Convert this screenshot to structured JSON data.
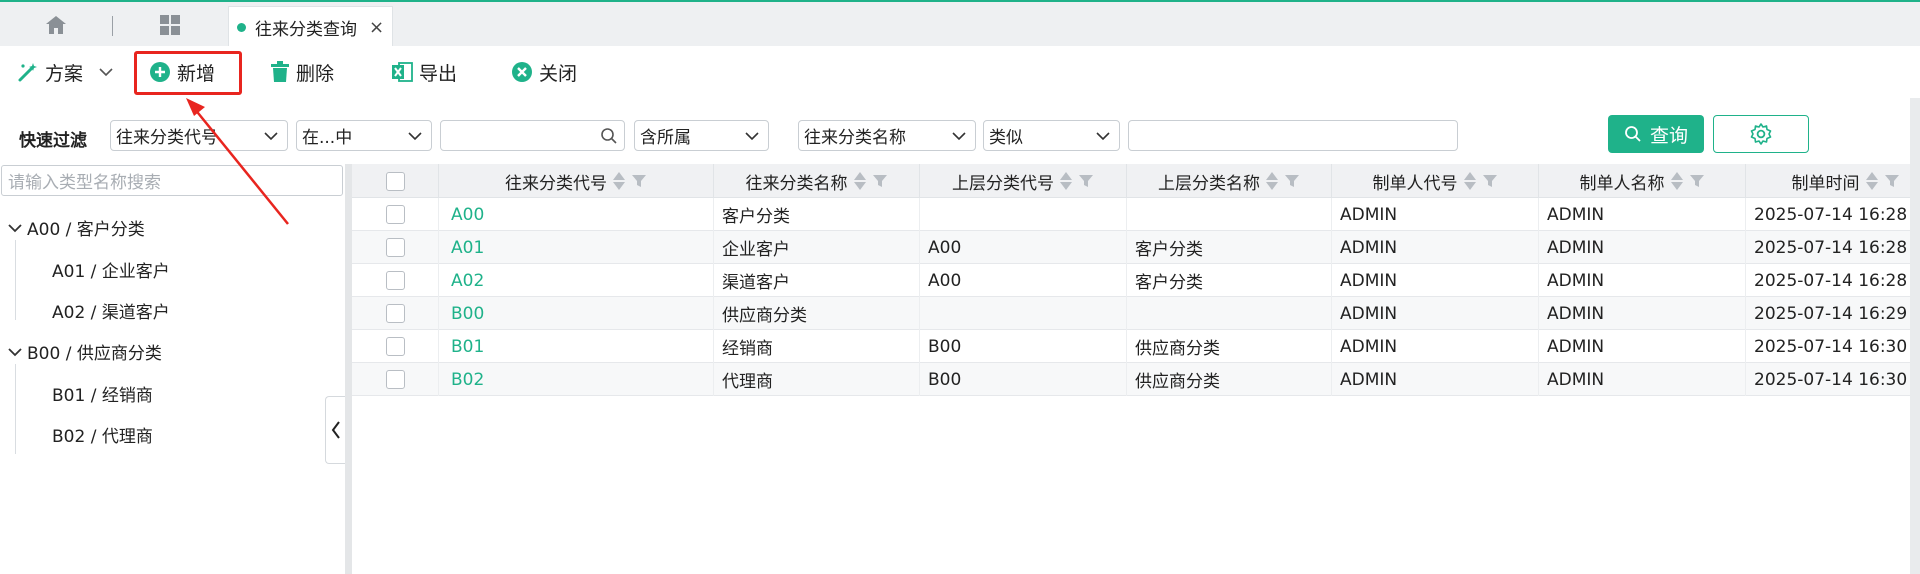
{
  "topbar": {
    "home_icon": "home-icon",
    "apps_icon": "grid-icon",
    "page_tab": {
      "label": "往来分类查询",
      "close": "×"
    }
  },
  "toolbar": {
    "plan_label": "方案",
    "add_label": "新增",
    "delete_label": "删除",
    "export_label": "导出",
    "close_label": "关闭"
  },
  "filter": {
    "label": "快速过滤",
    "field1": "往来分类代号",
    "op1": "在...中",
    "value1": "",
    "scope": "含所属",
    "field2": "往来分类名称",
    "op2": "类似",
    "value2": "",
    "query_label": "查询"
  },
  "tree": {
    "search_placeholder": "请输入类型名称搜索",
    "nodes": [
      {
        "label": "A00 / 客户分类",
        "children": [
          "A01 / 企业客户",
          "A02 / 渠道客户"
        ]
      },
      {
        "label": "B00 / 供应商分类",
        "children": [
          "B01 / 经销商",
          "B02 / 代理商"
        ]
      }
    ]
  },
  "grid": {
    "headers": [
      "往来分类代号",
      "往来分类名称",
      "上层分类代号",
      "上层分类名称",
      "制单人代号",
      "制单人名称",
      "制单时间"
    ],
    "rows": [
      [
        "A00",
        "客户分类",
        "",
        "",
        "ADMIN",
        "ADMIN",
        "2025-07-14 16:28"
      ],
      [
        "A01",
        "企业客户",
        "A00",
        "客户分类",
        "ADMIN",
        "ADMIN",
        "2025-07-14 16:28"
      ],
      [
        "A02",
        "渠道客户",
        "A00",
        "客户分类",
        "ADMIN",
        "ADMIN",
        "2025-07-14 16:28"
      ],
      [
        "B00",
        "供应商分类",
        "",
        "",
        "ADMIN",
        "ADMIN",
        "2025-07-14 16:29"
      ],
      [
        "B01",
        "经销商",
        "B00",
        "供应商分类",
        "ADMIN",
        "ADMIN",
        "2025-07-14 16:30"
      ],
      [
        "B02",
        "代理商",
        "B00",
        "供应商分类",
        "ADMIN",
        "ADMIN",
        "2025-07-14 16:30"
      ]
    ]
  },
  "colors": {
    "accent": "#1fb28a",
    "highlight": "#e8251f"
  }
}
